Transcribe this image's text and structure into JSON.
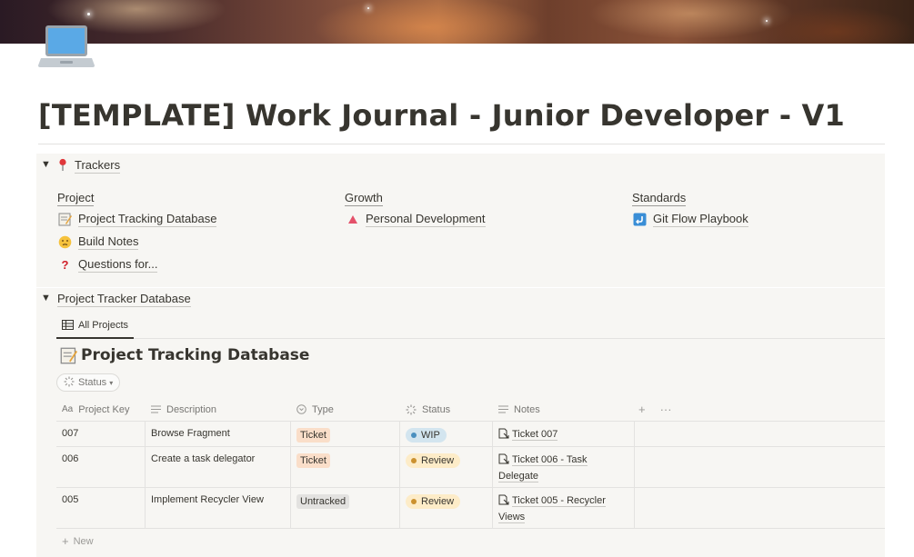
{
  "page": {
    "icon": "laptop-icon",
    "title": "[TEMPLATE] Work Journal - Junior Developer - V1"
  },
  "trackers": {
    "toggle_label": "Trackers",
    "toggle_icon": "pushpin-icon",
    "columns": [
      {
        "heading": "Project",
        "links": [
          {
            "label": "Project Tracking Database",
            "icon": "memo-icon"
          },
          {
            "label": "Build Notes",
            "icon": "thinking-face-icon"
          },
          {
            "label": "Questions for...",
            "icon": "question-mark-icon"
          }
        ]
      },
      {
        "heading": "Growth",
        "links": [
          {
            "label": "Personal Development",
            "icon": "triangle-up-icon"
          }
        ]
      },
      {
        "heading": "Standards",
        "links": [
          {
            "label": "Git Flow Playbook",
            "icon": "return-arrow-icon"
          }
        ]
      }
    ]
  },
  "database_toggle": {
    "toggle_label": "Project Tracker Database",
    "view_tab": "All Projects",
    "db_title": "Project Tracking Database",
    "filter_label": "Status",
    "columns": {
      "key": "Project Key",
      "description": "Description",
      "type": "Type",
      "status": "Status",
      "notes": "Notes"
    },
    "add_column": "+",
    "more": "···",
    "rows": [
      {
        "key": "007",
        "description": "Browse Fragment",
        "type": "Ticket",
        "status": "WIP",
        "notes_1": "Ticket 007",
        "notes_2": ""
      },
      {
        "key": "006",
        "description": "Create a task delegator",
        "type": "Ticket",
        "status": "Review",
        "notes_1": "Ticket 006 - Task",
        "notes_2": "Delegate"
      },
      {
        "key": "005",
        "description": "Implement Recycler View",
        "type": "Untracked",
        "status": "Review",
        "notes_1": "Ticket 005 - Recycler",
        "notes_2": "Views"
      }
    ],
    "new_label": "New"
  },
  "colors": {
    "ticket_tag": "#fadec9",
    "untracked_tag": "#e3e2e0",
    "wip_status": "#d3e5ef",
    "review_status": "#fdecc8",
    "toggle_bg": "#f7f6f3"
  }
}
